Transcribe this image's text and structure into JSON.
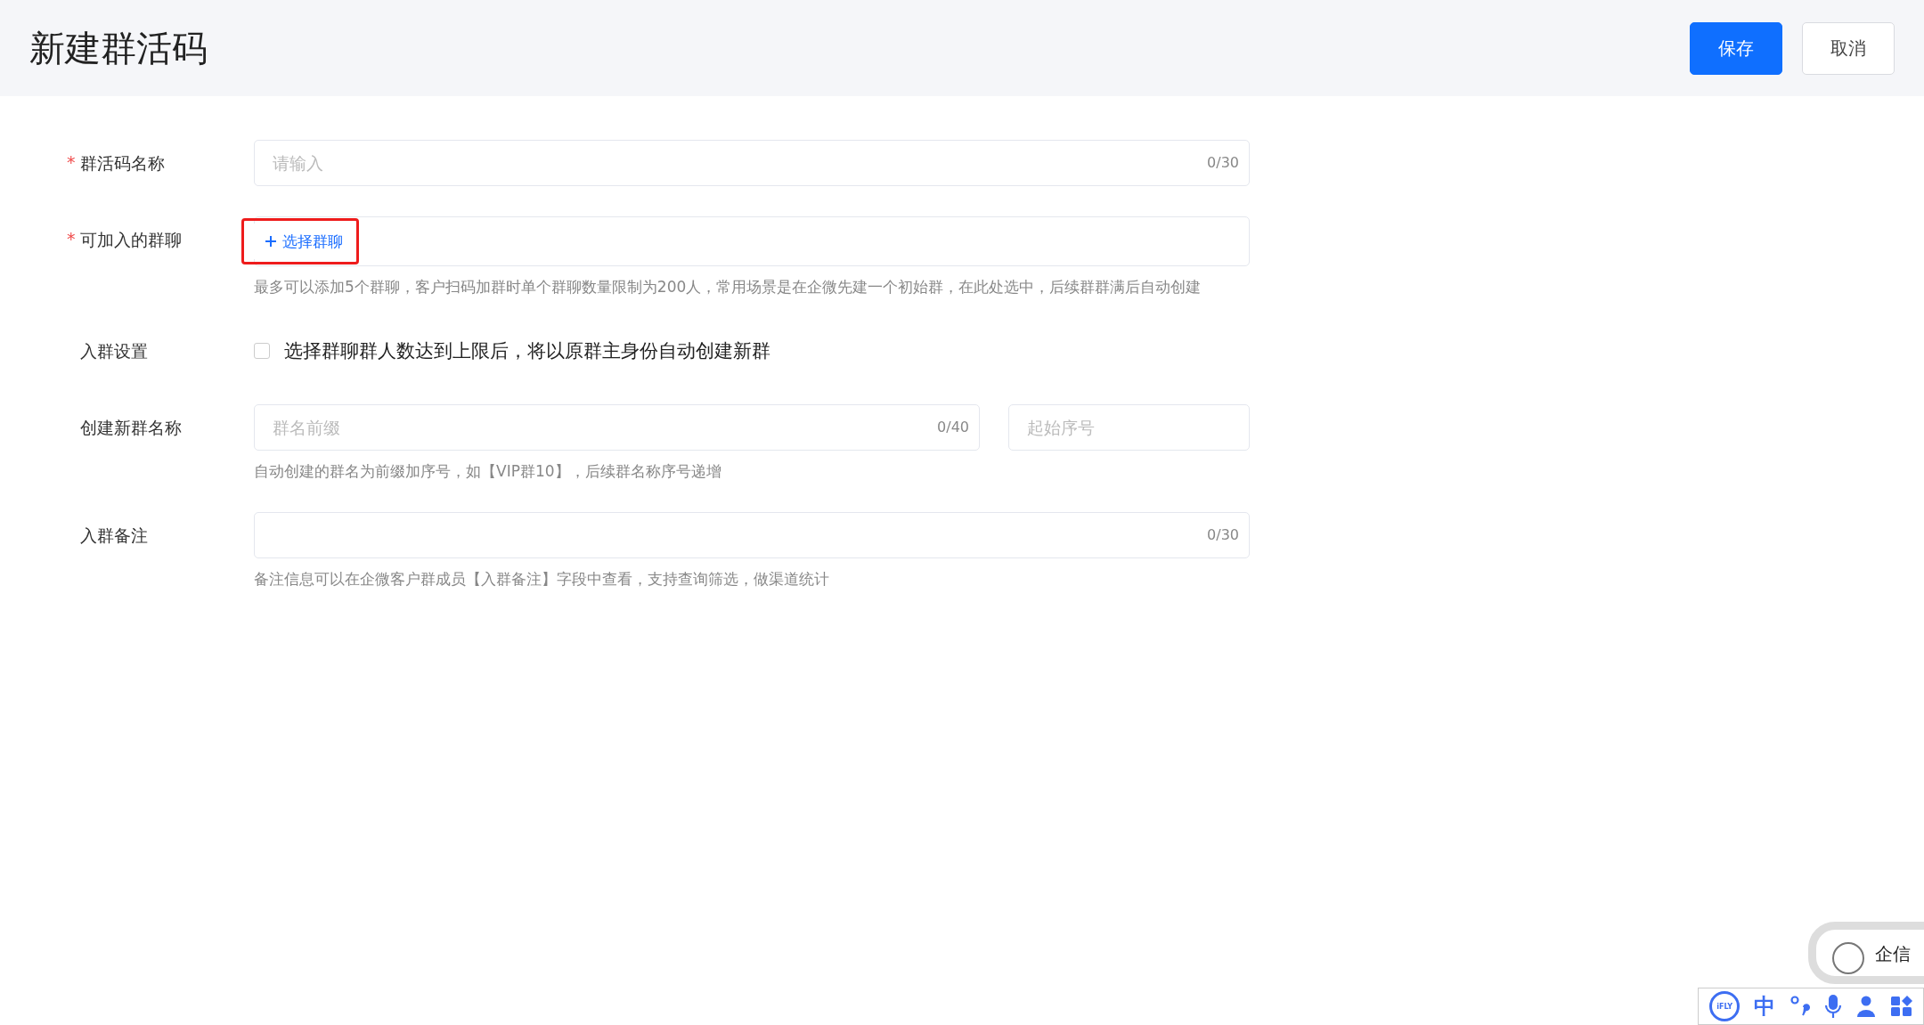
{
  "header": {
    "title": "新建群活码",
    "buttons": [
      {
        "label": "保存",
        "kind": "primary"
      },
      {
        "label": "取消",
        "kind": "default"
      }
    ]
  },
  "form": [
    {
      "kind": "text",
      "label": "群活码名称",
      "required_mark": "*",
      "placeholder": "请输入",
      "counter": "0/30"
    },
    {
      "kind": "picker",
      "label": "可加入的群聊",
      "required_mark": "*",
      "button": "选择群聊",
      "highlighted": true,
      "hint": "最多可以添加5个群聊，客户扫码加群时单个群聊数量限制为200人，常用场景是在企微先建一个初始群，在此处选中，后续群群满后自动创建"
    },
    {
      "kind": "checkbox",
      "label": "入群设置",
      "text": "选择群聊群人数达到上限后，将以原群主身份自动创建新群",
      "checked": false
    },
    {
      "kind": "pair",
      "label": "创建新群名称",
      "placeholder": "群名前缀",
      "counter": "0/40",
      "placeholder2": "起始序号",
      "hint": "自动创建的群名为前缀加序号，如【VIP群10】，后续群名称序号递增"
    },
    {
      "kind": "text",
      "label": "入群备注",
      "counter": "0/30",
      "hint": "备注信息可以在企微客户群成员【入群备注】字段中查看，支持查询筛选，做渠道统计"
    }
  ],
  "widget": {
    "text": "企信"
  },
  "ime_toolbar": {
    "logo": "iFLY",
    "mode": "中"
  }
}
